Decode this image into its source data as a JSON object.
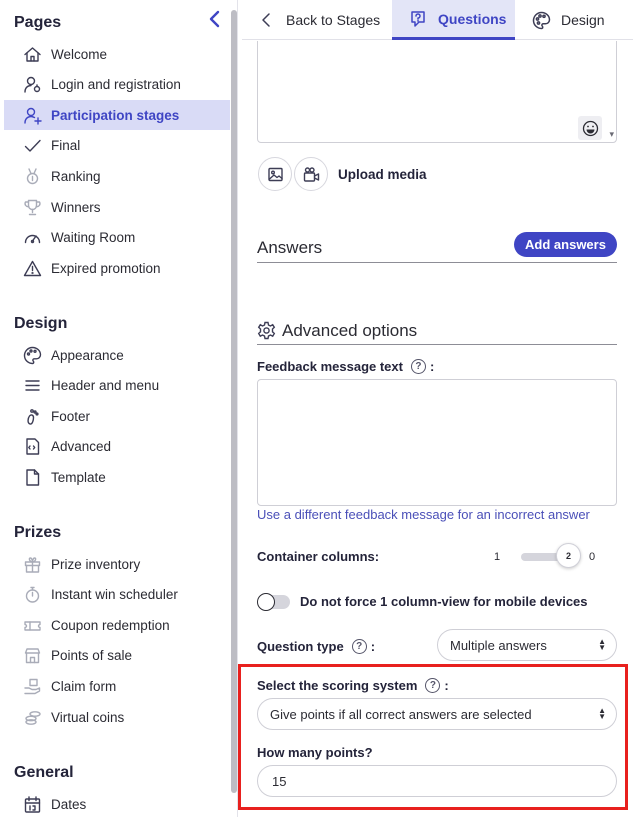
{
  "sidebar": {
    "sections": [
      {
        "title": "Pages",
        "items": [
          {
            "label": "Welcome",
            "icon": "home-icon"
          },
          {
            "label": "Login and registration",
            "icon": "user-key-icon"
          },
          {
            "label": "Participation stages",
            "icon": "user-plus-icon",
            "active": true
          },
          {
            "label": "Final",
            "icon": "check-icon"
          },
          {
            "label": "Ranking",
            "icon": "medal-icon",
            "muted": true
          },
          {
            "label": "Winners",
            "icon": "trophy-icon",
            "muted": true
          },
          {
            "label": "Waiting Room",
            "icon": "gauge-icon"
          },
          {
            "label": "Expired promotion",
            "icon": "warning-icon"
          }
        ]
      },
      {
        "title": "Design",
        "items": [
          {
            "label": "Appearance",
            "icon": "palette-icon"
          },
          {
            "label": "Header and menu",
            "icon": "menu-icon"
          },
          {
            "label": "Footer",
            "icon": "footprint-icon"
          },
          {
            "label": "Advanced",
            "icon": "code-doc-icon"
          },
          {
            "label": "Template",
            "icon": "file-icon"
          }
        ]
      },
      {
        "title": "Prizes",
        "items": [
          {
            "label": "Prize inventory",
            "icon": "gift-icon",
            "muted": true
          },
          {
            "label": "Instant win scheduler",
            "icon": "stopwatch-icon",
            "muted": true
          },
          {
            "label": "Coupon redemption",
            "icon": "coupon-icon",
            "muted": true
          },
          {
            "label": "Points of sale",
            "icon": "store-icon",
            "muted": true
          },
          {
            "label": "Claim form",
            "icon": "hand-box-icon",
            "muted": true
          },
          {
            "label": "Virtual coins",
            "icon": "coins-icon",
            "muted": true
          }
        ]
      },
      {
        "title": "General",
        "items": [
          {
            "label": "Dates",
            "icon": "calendar-icon"
          }
        ]
      }
    ]
  },
  "tabs": {
    "back": "Back to Stages",
    "questions": "Questions",
    "design": "Design"
  },
  "media": {
    "upload_label": "Upload media"
  },
  "answers": {
    "title": "Answers",
    "add_button": "Add answers"
  },
  "advanced": {
    "title": "Advanced options",
    "feedback_label": "Feedback message text",
    "feedback_colon": ":",
    "incorrect_link": "Use a different feedback message for an incorrect answer",
    "container_columns_label": "Container columns:",
    "columns_min": "1",
    "columns_value": "2",
    "columns_max": "0",
    "mobile_toggle_label": "Do not force 1 column-view for mobile devices",
    "question_type_label": "Question type",
    "question_type_value": "Multiple answers",
    "scoring_label": "Select the scoring system",
    "scoring_value": "Give points if all correct answers are selected",
    "points_label": "How many points?",
    "points_value": "15",
    "help_glyph": "?"
  },
  "colors": {
    "accent": "#3f45c4",
    "active_bg": "#d9dbf6",
    "highlight": "#e8201e"
  }
}
